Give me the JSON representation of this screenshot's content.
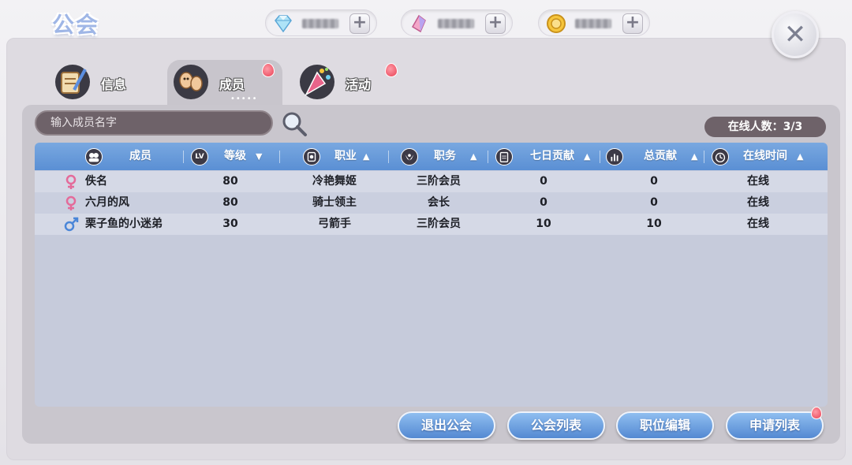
{
  "header": {
    "title": "公会"
  },
  "currencies": [
    {
      "icon": "diamond-icon"
    },
    {
      "icon": "crystal-icon"
    },
    {
      "icon": "coin-icon"
    }
  ],
  "tabs": [
    {
      "label": "信息",
      "icon": "scroll-quill-icon"
    },
    {
      "label": "成员",
      "icon": "members-icon",
      "dots": "•••••"
    },
    {
      "label": "活动",
      "icon": "party-popper-icon"
    }
  ],
  "search": {
    "placeholder": "输入成员名字"
  },
  "online": {
    "text": "在线人数：3/3"
  },
  "table": {
    "columns": [
      {
        "label": "成员",
        "icon": "members-icon"
      },
      {
        "label": "等级",
        "icon": "lv-icon",
        "icon_text": "LV",
        "sort": "▼"
      },
      {
        "label": "职业",
        "icon": "job-card-icon",
        "sort": "▲"
      },
      {
        "label": "职务",
        "icon": "wings-icon",
        "sort": "▲"
      },
      {
        "label": "七日贡献",
        "icon": "clipboard-icon",
        "sort": "▲"
      },
      {
        "label": "总贡献",
        "icon": "bar-chart-icon",
        "sort": "▲"
      },
      {
        "label": "在线时间",
        "icon": "alarm-clock-icon",
        "sort": "▲"
      }
    ],
    "rows": [
      {
        "gender": "female",
        "name": "佚名",
        "level": "80",
        "job": "冷艳舞姬",
        "role": "三阶会员",
        "week": "0",
        "total": "0",
        "status": "在线"
      },
      {
        "gender": "female",
        "name": "六月的风",
        "level": "80",
        "job": "骑士领主",
        "role": "会长",
        "week": "0",
        "total": "0",
        "status": "在线"
      },
      {
        "gender": "male",
        "name": "栗子鱼的小迷弟",
        "level": "30",
        "job": "弓箭手",
        "role": "三阶会员",
        "week": "10",
        "total": "10",
        "status": "在线"
      }
    ]
  },
  "buttons": {
    "leave": "退出公会",
    "list": "公会列表",
    "edit": "职位编辑",
    "apply": "申请列表"
  },
  "colors": {
    "header_blue": "#5a8fd4",
    "button_blue": "#6b9fe0",
    "female_pink": "#e46b9a",
    "male_blue": "#4a86d8",
    "notify_red": "#e84356"
  }
}
